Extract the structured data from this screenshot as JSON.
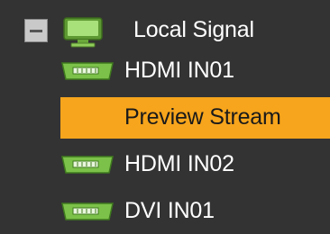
{
  "tree": {
    "root": {
      "label": "Local Signal",
      "expanded": true,
      "icon": "monitor-icon"
    },
    "items": [
      {
        "label": "HDMI IN01",
        "icon": "video-port-icon",
        "selected": false
      },
      {
        "label": "Preview Stream",
        "icon": null,
        "selected": true
      },
      {
        "label": "HDMI IN02",
        "icon": "video-port-icon",
        "selected": false
      },
      {
        "label": "DVI IN01",
        "icon": "video-port-icon",
        "selected": false
      }
    ]
  },
  "colors": {
    "background": "#333333",
    "selection": "#f7a51c",
    "icon_green": "#7cc24a",
    "text": "#ffffff"
  }
}
